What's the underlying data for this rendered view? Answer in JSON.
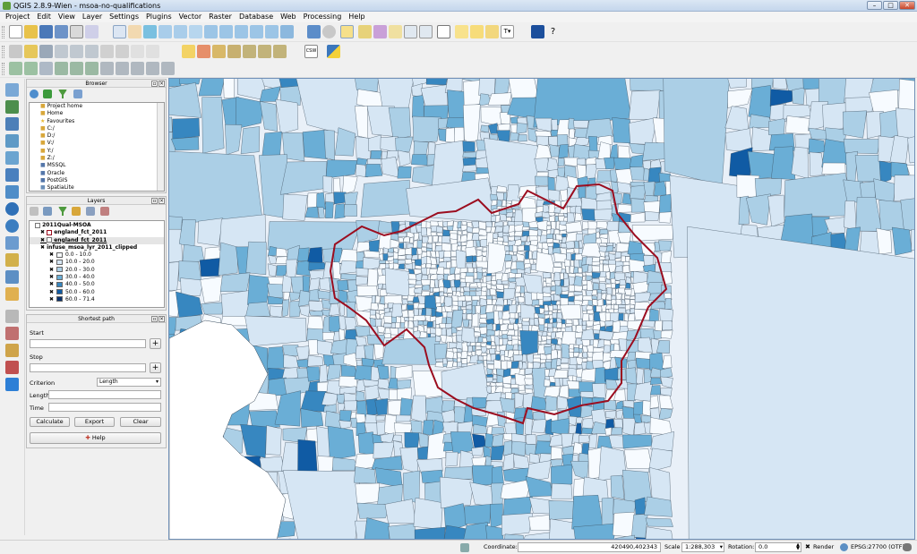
{
  "window": {
    "title": "QGIS 2.8.9-Wien - msoa-no-qualifications",
    "minimize": "–",
    "maximize": "□",
    "close": "✕"
  },
  "menu": [
    "Project",
    "Edit",
    "View",
    "Layer",
    "Settings",
    "Plugins",
    "Vector",
    "Raster",
    "Database",
    "Web",
    "Processing",
    "Help"
  ],
  "toolbar": {
    "tools_dropdown": "T▾",
    "csw_label": "CSW"
  },
  "browser": {
    "title": "Browser",
    "items": [
      "Project home",
      "Home",
      "Favourites",
      "C:/",
      "D:/",
      "V:/",
      "Y:/",
      "Z:/",
      "MSSQL",
      "Oracle",
      "PostGIS",
      "SpatiaLite"
    ]
  },
  "layers": {
    "title": "Layers",
    "group": "2011Qual-MSOA",
    "layer_a": "england_fct_2011",
    "layer_b": "england_fct_2011",
    "layer_c": "infuse_msoa_lyr_2011_clipped",
    "classes": [
      {
        "label": "0.0 - 10.0",
        "color": "#f7fbff"
      },
      {
        "label": "10.0 - 20.0",
        "color": "#d6e6f4"
      },
      {
        "label": "20.0 - 30.0",
        "color": "#abcfe6"
      },
      {
        "label": "30.0 - 40.0",
        "color": "#6aaed6"
      },
      {
        "label": "40.0 - 50.0",
        "color": "#3787c0"
      },
      {
        "label": "50.0 - 60.0",
        "color": "#105ba4"
      },
      {
        "label": "60.0 - 71.4",
        "color": "#08306b"
      }
    ],
    "boundary_color": "#9b0d1f"
  },
  "shortest_path": {
    "title": "Shortest path",
    "start_label": "Start",
    "stop_label": "Stop",
    "criterion_label": "Criterion",
    "criterion_value": "Length",
    "length_label": "Length",
    "time_label": "Time",
    "calculate": "Calculate",
    "export": "Export",
    "clear": "Clear",
    "help": "Help"
  },
  "status": {
    "coordinate_label": "Coordinate:",
    "coordinate_value": "420490,402343",
    "scale_label": "Scale",
    "scale_value": "1:288,303",
    "rotation_label": "Rotation:",
    "rotation_value": "0.0",
    "render_label": "Render",
    "crs": "EPSG:27700 (OTF)"
  }
}
